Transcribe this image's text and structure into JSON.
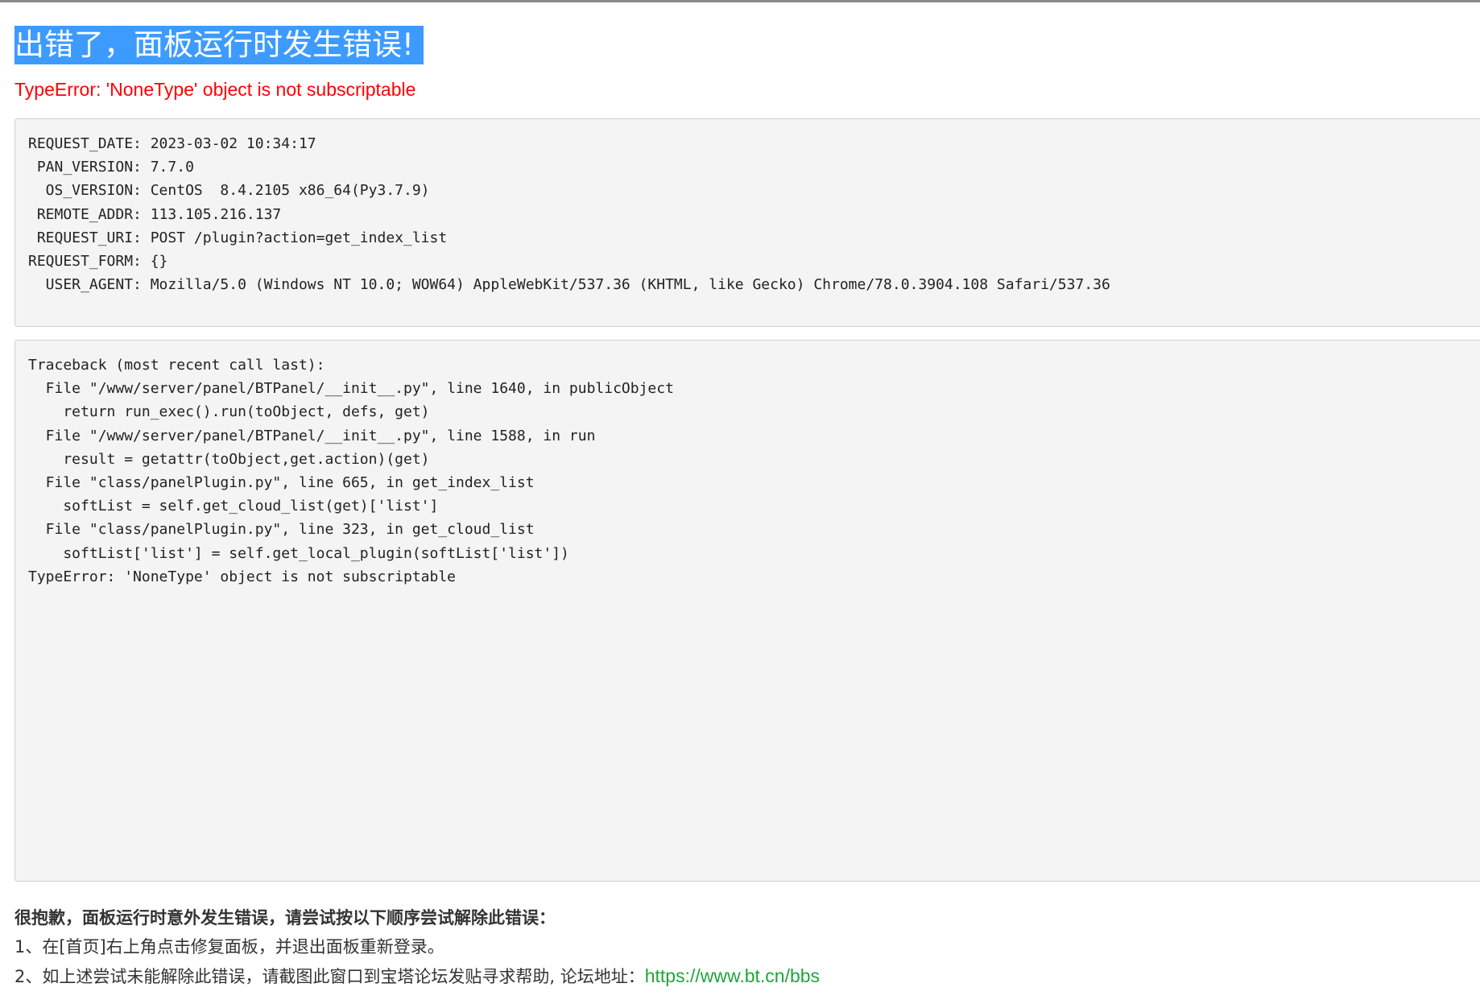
{
  "page": {
    "title": "出错了，面板运行时发生错误!",
    "error_message": "TypeError: 'NoneType' object is not subscriptable"
  },
  "request_info": {
    "lines": [
      "REQUEST_DATE: 2023-03-02 10:34:17",
      " PAN_VERSION: 7.7.0",
      "  OS_VERSION: CentOS  8.4.2105 x86_64(Py3.7.9)",
      " REMOTE_ADDR: 113.105.216.137",
      " REQUEST_URI: POST /plugin?action=get_index_list",
      "REQUEST_FORM: {}",
      "  USER_AGENT: Mozilla/5.0 (Windows NT 10.0; WOW64) AppleWebKit/537.36 (KHTML, like Gecko) Chrome/78.0.3904.108 Safari/537.36"
    ]
  },
  "traceback": {
    "lines": [
      "Traceback (most recent call last):",
      "  File \"/www/server/panel/BTPanel/__init__.py\", line 1640, in publicObject",
      "    return run_exec().run(toObject, defs, get)",
      "  File \"/www/server/panel/BTPanel/__init__.py\", line 1588, in run",
      "    result = getattr(toObject,get.action)(get)",
      "  File \"class/panelPlugin.py\", line 665, in get_index_list",
      "    softList = self.get_cloud_list(get)['list']",
      "  File \"class/panelPlugin.py\", line 323, in get_cloud_list",
      "    softList['list'] = self.get_local_plugin(softList['list'])",
      "TypeError: 'NoneType' object is not subscriptable"
    ]
  },
  "notice": {
    "heading": "很抱歉，面板运行时意外发生错误，请尝试按以下顺序尝试解除此错误：",
    "step1": "1、在[首页]右上角点击修复面板，并退出面板重新登录。",
    "step2": "2、如上述尝试未能解除此错误，请截图此窗口到宝塔论坛发贴寻求帮助, 论坛地址：",
    "forum_link": "https://www.bt.cn/bbs",
    "link_color": "#20a53a"
  }
}
